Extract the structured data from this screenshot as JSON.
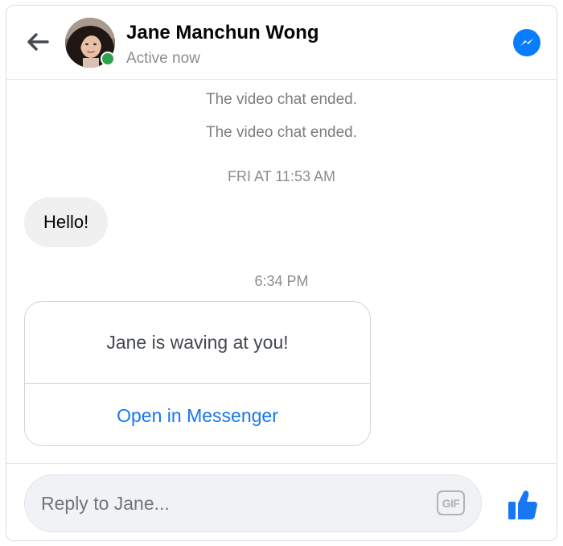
{
  "header": {
    "contact_name": "Jane Manchun Wong",
    "status": "Active now",
    "presence_color": "#31a24c",
    "back_icon": "arrow-left-icon",
    "messenger_icon": "messenger-icon"
  },
  "thread": {
    "system_messages": [
      "The video chat ended.",
      "The video chat ended."
    ],
    "timestamps": [
      "FRI AT 11:53 AM",
      "6:34 PM"
    ],
    "incoming_message": "Hello!",
    "wave_card": {
      "title": "Jane is waving at you!",
      "action_label": "Open in Messenger"
    }
  },
  "composer": {
    "placeholder": "Reply to Jane...",
    "value": "",
    "gif_label": "GIF",
    "like_icon": "thumbs-up-icon"
  },
  "colors": {
    "accent": "#1877f2",
    "messenger_blue": "#0a7cff",
    "bubble_bg": "#f0f0f0"
  }
}
